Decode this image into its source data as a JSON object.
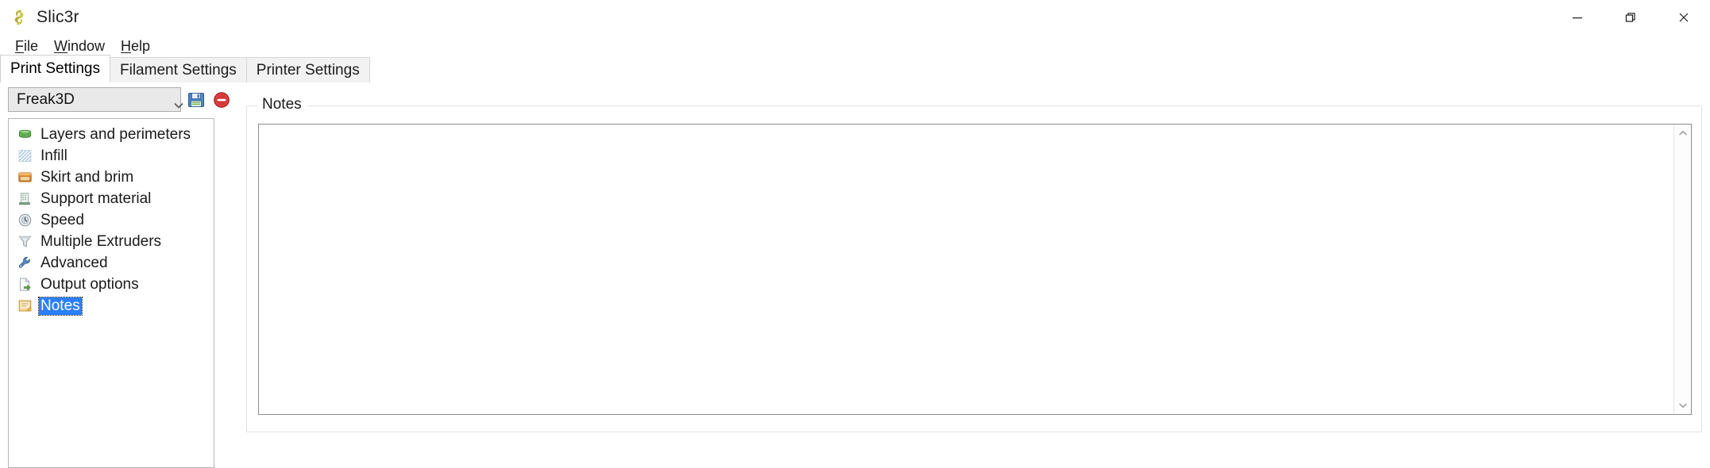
{
  "window": {
    "title": "Slic3r",
    "app_icon": "slic3r-logo-icon",
    "controls": {
      "minimize": "minimize-icon",
      "restore": "restore-icon",
      "close": "close-icon"
    }
  },
  "menubar": {
    "items": [
      {
        "label": "File",
        "mnemonic": "F"
      },
      {
        "label": "Window",
        "mnemonic": "W"
      },
      {
        "label": "Help",
        "mnemonic": "H"
      }
    ]
  },
  "tabs": [
    {
      "label": "Print Settings",
      "active": true
    },
    {
      "label": "Filament Settings",
      "active": false
    },
    {
      "label": "Printer Settings",
      "active": false
    }
  ],
  "preset": {
    "selected": "Freak3D",
    "options": [
      "Freak3D"
    ],
    "save_icon": "floppy-disk-save-icon",
    "delete_icon": "delete-preset-icon"
  },
  "sidebar": {
    "items": [
      {
        "label": "Layers and perimeters",
        "icon": "layers-icon",
        "selected": false
      },
      {
        "label": "Infill",
        "icon": "infill-hatch-icon",
        "selected": false
      },
      {
        "label": "Skirt and brim",
        "icon": "skirt-brim-icon",
        "selected": false
      },
      {
        "label": "Support material",
        "icon": "support-material-icon",
        "selected": false
      },
      {
        "label": "Speed",
        "icon": "speed-clock-icon",
        "selected": false
      },
      {
        "label": "Multiple Extruders",
        "icon": "funnel-icon",
        "selected": false
      },
      {
        "label": "Advanced",
        "icon": "wrench-icon",
        "selected": false
      },
      {
        "label": "Output options",
        "icon": "output-page-icon",
        "selected": false
      },
      {
        "label": "Notes",
        "icon": "notes-icon",
        "selected": true
      }
    ]
  },
  "main": {
    "group_title": "Notes",
    "notes_value": "",
    "notes_placeholder": "",
    "scrollbar": {
      "up_icon": "chevron-up-icon",
      "down_icon": "chevron-down-icon"
    }
  },
  "colors": {
    "accent_selection": "#2a7fff",
    "window_bg": "#ffffff",
    "tab_inactive_bg": "#f2f2f2",
    "combo_bg": "#e9e9e9",
    "border": "#b6b6b6"
  }
}
